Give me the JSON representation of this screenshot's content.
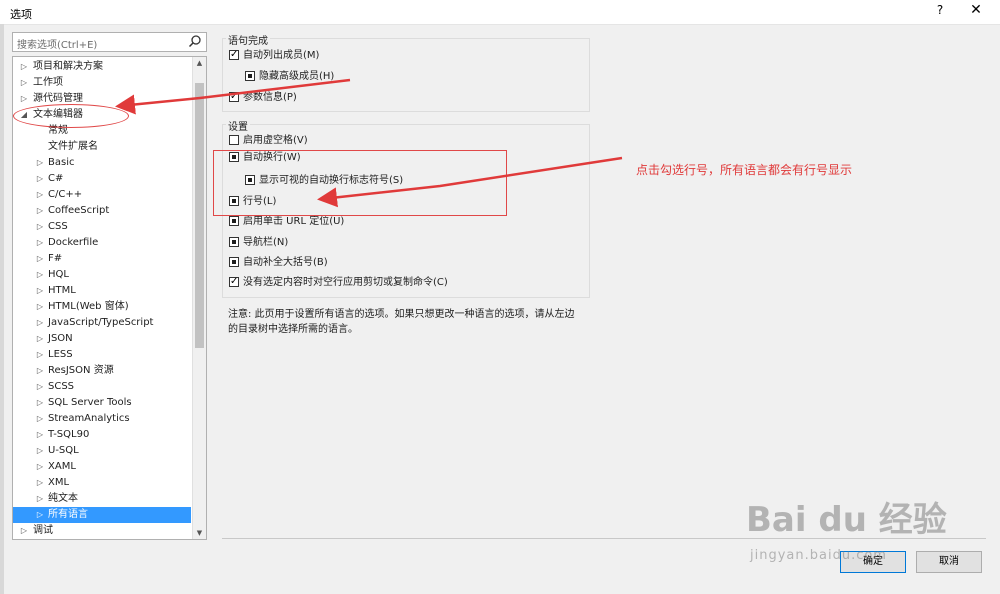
{
  "window": {
    "title": "选项",
    "help": "?",
    "close": "✕"
  },
  "search": {
    "placeholder": "搜索选项(Ctrl+E)"
  },
  "tree": {
    "items": [
      {
        "label": "项目和解决方案",
        "arrow": "▷"
      },
      {
        "label": "工作项",
        "arrow": "▷"
      },
      {
        "label": "源代码管理",
        "arrow": "▷"
      },
      {
        "label": "文本编辑器",
        "arrow": "◢"
      },
      {
        "label": "常规",
        "arrow": ""
      },
      {
        "label": "文件扩展名",
        "arrow": ""
      },
      {
        "label": "Basic",
        "arrow": "▷"
      },
      {
        "label": "C#",
        "arrow": "▷"
      },
      {
        "label": "C/C++",
        "arrow": "▷"
      },
      {
        "label": "CoffeeScript",
        "arrow": "▷"
      },
      {
        "label": "CSS",
        "arrow": "▷"
      },
      {
        "label": "Dockerfile",
        "arrow": "▷"
      },
      {
        "label": "F#",
        "arrow": "▷"
      },
      {
        "label": "HQL",
        "arrow": "▷"
      },
      {
        "label": "HTML",
        "arrow": "▷"
      },
      {
        "label": "HTML(Web 窗体)",
        "arrow": "▷"
      },
      {
        "label": "JavaScript/TypeScript",
        "arrow": "▷"
      },
      {
        "label": "JSON",
        "arrow": "▷"
      },
      {
        "label": "LESS",
        "arrow": "▷"
      },
      {
        "label": "ResJSON 资源",
        "arrow": "▷"
      },
      {
        "label": "SCSS",
        "arrow": "▷"
      },
      {
        "label": "SQL Server Tools",
        "arrow": "▷"
      },
      {
        "label": "StreamAnalytics",
        "arrow": "▷"
      },
      {
        "label": "T-SQL90",
        "arrow": "▷"
      },
      {
        "label": "U-SQL",
        "arrow": "▷"
      },
      {
        "label": "XAML",
        "arrow": "▷"
      },
      {
        "label": "XML",
        "arrow": "▷"
      },
      {
        "label": "纯文本",
        "arrow": "▷"
      },
      {
        "label": "所有语言",
        "arrow": "▷"
      },
      {
        "label": "调试",
        "arrow": "▷"
      }
    ]
  },
  "statement_completion": {
    "label": "语句完成",
    "options": [
      {
        "label": "自动列出成员(M)",
        "state": "checked"
      },
      {
        "label": "隐藏高级成员(H)",
        "state": "partial"
      },
      {
        "label": "参数信息(P)",
        "state": "checked"
      }
    ]
  },
  "settings": {
    "label": "设置",
    "options": [
      {
        "label": "启用虚空格(V)",
        "state": "unchecked"
      },
      {
        "label": "自动换行(W)",
        "state": "partial"
      },
      {
        "label": "显示可视的自动换行标志符号(S)",
        "state": "partial"
      },
      {
        "label": "行号(L)",
        "state": "partial"
      },
      {
        "label": "启用单击 URL 定位(U)",
        "state": "partial"
      },
      {
        "label": "导航栏(N)",
        "state": "partial"
      },
      {
        "label": "自动补全大括号(B)",
        "state": "partial"
      },
      {
        "label": "没有选定内容时对空行应用剪切或复制命令(C)",
        "state": "checked"
      }
    ]
  },
  "note": "注意: 此页用于设置所有语言的选项。如果只想更改一种语言的选项，请从左边的目录树中选择所需的语言。",
  "annotation": "点击勾选行号，所有语言都会有行号显示",
  "buttons": {
    "ok": "确定",
    "cancel": "取消"
  },
  "watermark": {
    "text": "Bai du 经验",
    "sub": "jingyan.baidu.com"
  },
  "colors": {
    "selection": "#3399ff",
    "annotation": "#e03a3a"
  }
}
